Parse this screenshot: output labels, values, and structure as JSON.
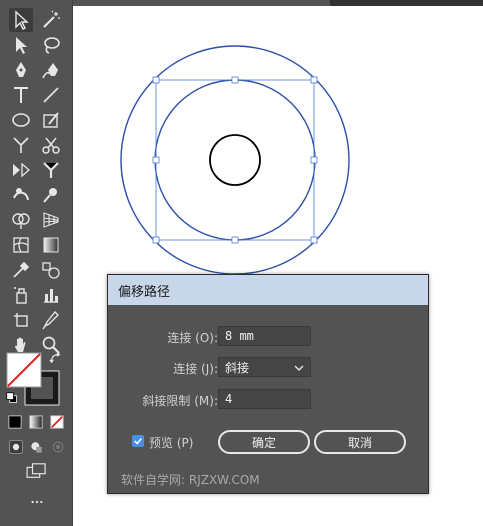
{
  "dialog": {
    "title": "偏移路径",
    "offset": {
      "label": "连接 (O):",
      "value": "8 mm"
    },
    "join": {
      "label": "连接 (J):",
      "selected": "斜接"
    },
    "miter": {
      "label": "斜接限制 (M):",
      "value": "4"
    },
    "preview": {
      "label": "预览 (P)",
      "checked": true
    },
    "ok_label": "确定",
    "cancel_label": "取消",
    "watermark": "软件自学网: RJZXW.COM"
  },
  "colors": {
    "accent": "#4a90e2",
    "selection": "#2b4fa8",
    "titlebar": "#c7d6e8"
  },
  "tools": [
    "selection-icon",
    "magic-wand-icon",
    "direct-selection-icon",
    "lasso-icon",
    "pen-icon",
    "curvature-icon",
    "type-icon",
    "line-segment-icon",
    "ellipse-icon",
    "paintbrush-icon",
    "shaper-icon",
    "scissors-icon",
    "rotate-icon",
    "width-icon",
    "warp-icon",
    "puppet-warp-icon",
    "shape-builder-icon",
    "perspective-grid-icon",
    "mesh-icon",
    "gradient-icon",
    "eyedropper-icon",
    "blend-icon",
    "symbol-sprayer-icon",
    "column-graph-icon",
    "artboard-icon",
    "slice-icon",
    "hand-icon",
    "zoom-icon",
    "fill-stroke-icon",
    "swap-icon",
    "default-colors-icon",
    "color-mode-icon",
    "gradient-mode-icon",
    "none-mode-icon",
    "draw-mode-icon",
    "screen-mode-icon",
    "more-tools-icon"
  ]
}
